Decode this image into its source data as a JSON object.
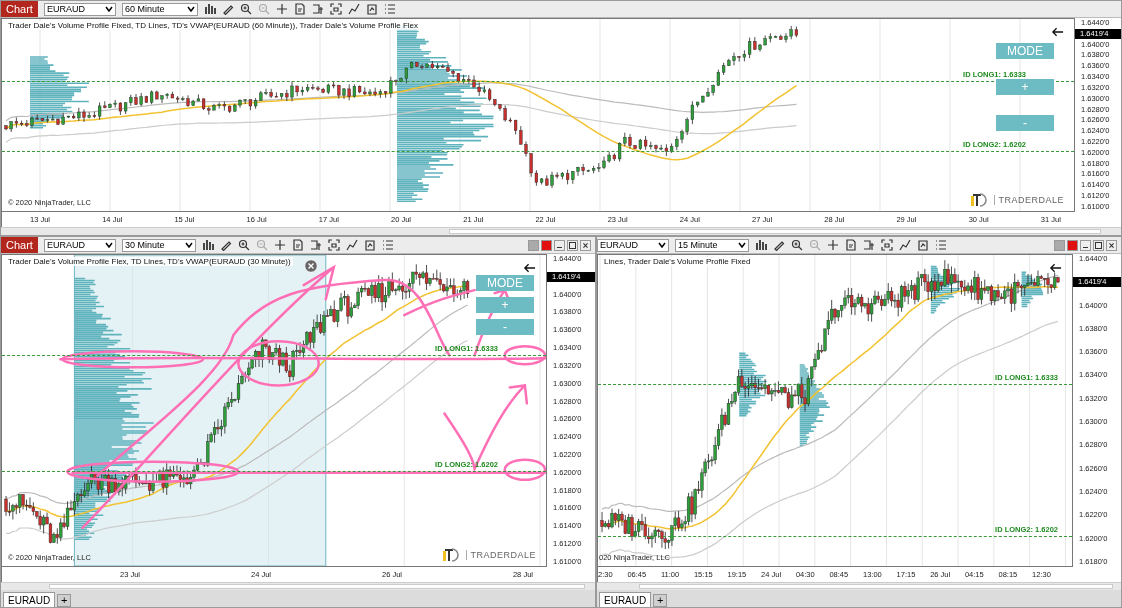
{
  "charts": [
    {
      "toolbar": {
        "label": "Chart",
        "instrument": "EURAUD",
        "interval": "60 Minute"
      },
      "indicator_title": "Trader Dale's Volume Profile Fixed, TD Lines, TD's VWAP(EURAUD (60 Minute)), Trader Dale's Volume Profile Flex",
      "price_axis": [
        {
          "kind": "tick",
          "text": "1.6440'0"
        },
        {
          "kind": "current",
          "text": "1.6419'4"
        },
        {
          "kind": "tick",
          "text": "1.6400'0"
        },
        {
          "kind": "tick",
          "text": "1.6380'0"
        },
        {
          "kind": "tick",
          "text": "1.6360'0"
        },
        {
          "kind": "tick",
          "text": "1.6340'0"
        },
        {
          "kind": "tick",
          "text": "1.6320'0"
        },
        {
          "kind": "tick",
          "text": "1.6300'0"
        },
        {
          "kind": "tick",
          "text": "1.6280'0"
        },
        {
          "kind": "tick",
          "text": "1.6260'0"
        },
        {
          "kind": "tick",
          "text": "1.6240'0"
        },
        {
          "kind": "tick",
          "text": "1.6220'0"
        },
        {
          "kind": "tick",
          "text": "1.6200'0"
        },
        {
          "kind": "tick",
          "text": "1.6180'0"
        },
        {
          "kind": "tick",
          "text": "1.6160'0"
        },
        {
          "kind": "tick",
          "text": "1.6140'0"
        },
        {
          "kind": "tick",
          "text": "1.6120'0"
        },
        {
          "kind": "tick",
          "text": "1.6100'0"
        }
      ],
      "id_lines": [
        {
          "label": "ID LONG1: 1.6333"
        },
        {
          "label": "ID LONG2: 1.6202"
        }
      ],
      "buttons": [
        "MODE",
        "+",
        "-"
      ],
      "copyright": "© 2020 NinjaTrader, LLC",
      "logo": "TRADERDALE",
      "date_labels": [
        "13 Jul",
        "14 Jul",
        "15 Jul",
        "16 Jul",
        "17 Jul",
        "20 Jul",
        "21 Jul",
        "22 Jul",
        "23 Jul",
        "24 Jul",
        "27 Jul",
        "28 Jul",
        "29 Jul",
        "30 Jul",
        "31 Jul"
      ]
    },
    {
      "toolbar": {
        "label": "Chart",
        "instrument": "EURAUD",
        "interval": "30 Minute"
      },
      "window_controls": true,
      "range_selection": true,
      "freehand_annotations": true,
      "indicator_title": "Trader Dale's Volume Profile Flex, TD Lines, TD's VWAP(EURAUD (30 Minute))",
      "price_axis": [
        {
          "kind": "tick",
          "text": "1.6440'0"
        },
        {
          "kind": "current",
          "text": "1.6419'4"
        },
        {
          "kind": "tick",
          "text": "1.6400'0"
        },
        {
          "kind": "tick",
          "text": "1.6380'0"
        },
        {
          "kind": "tick",
          "text": "1.6360'0"
        },
        {
          "kind": "tick",
          "text": "1.6340'0"
        },
        {
          "kind": "tick",
          "text": "1.6320'0"
        },
        {
          "kind": "tick",
          "text": "1.6300'0"
        },
        {
          "kind": "tick",
          "text": "1.6280'0"
        },
        {
          "kind": "tick",
          "text": "1.6260'0"
        },
        {
          "kind": "tick",
          "text": "1.6240'0"
        },
        {
          "kind": "tick",
          "text": "1.6220'0"
        },
        {
          "kind": "tick",
          "text": "1.6200'0"
        },
        {
          "kind": "tick",
          "text": "1.6180'0"
        },
        {
          "kind": "tick",
          "text": "1.6160'0"
        },
        {
          "kind": "tick",
          "text": "1.6140'0"
        },
        {
          "kind": "tick",
          "text": "1.6120'0"
        },
        {
          "kind": "tick",
          "text": "1.6100'0"
        }
      ],
      "id_lines": [
        {
          "label": "ID LONG1: 1.6333"
        },
        {
          "label": "ID LONG2: 1.6202"
        }
      ],
      "buttons": [
        "MODE",
        "+",
        "-"
      ],
      "copyright": "© 2020 NinjaTrader, LLC",
      "logo": "TRADERDALE",
      "date_labels": [
        "23 Jul",
        "24 Jul",
        "26 Jul",
        "28 Jul"
      ],
      "tabs": [
        {
          "label": "EURAUD",
          "selected": true
        }
      ],
      "new_tab": "+"
    },
    {
      "toolbar": {
        "instrument": "EURAUD",
        "interval": "15 Minute"
      },
      "window_controls": true,
      "indicator_title": "Lines, Trader Dale's Volume Profile Fixed",
      "price_axis": [
        {
          "kind": "tick",
          "text": "1.6440'0"
        },
        {
          "kind": "current",
          "text": "1.6419'4"
        },
        {
          "kind": "tick",
          "text": "1.6400'0"
        },
        {
          "kind": "tick",
          "text": "1.6380'0"
        },
        {
          "kind": "tick",
          "text": "1.6360'0"
        },
        {
          "kind": "tick",
          "text": "1.6340'0"
        },
        {
          "kind": "tick",
          "text": "1.6320'0"
        },
        {
          "kind": "tick",
          "text": "1.6300'0"
        },
        {
          "kind": "tick",
          "text": "1.6280'0"
        },
        {
          "kind": "tick",
          "text": "1.6260'0"
        },
        {
          "kind": "tick",
          "text": "1.6240'0"
        },
        {
          "kind": "tick",
          "text": "1.6220'0"
        },
        {
          "kind": "tick",
          "text": "1.6200'0"
        },
        {
          "kind": "tick",
          "text": "1.6180'0"
        }
      ],
      "id_lines": [
        {
          "label": "ID LONG1: 1.6333"
        },
        {
          "label": "ID LONG2: 1.6202"
        }
      ],
      "copyright": "020 NinjaTrader, LLC",
      "date_labels": [
        "2:30",
        "06:45",
        "11:00",
        "15:15",
        "19:15",
        "24 Jul",
        "04:30",
        "08:45",
        "13:00",
        "17:15",
        "26 Jul",
        "04:15",
        "08:15",
        "12:30"
      ],
      "tabs": [
        {
          "label": "EURAUD",
          "selected": true
        }
      ],
      "new_tab": "+"
    }
  ]
}
